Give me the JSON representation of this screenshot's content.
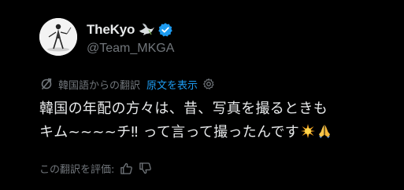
{
  "post": {
    "display_name": "TheKyo",
    "handle": "@Team_MKGA",
    "translation": {
      "translated_from": "韓国語からの翻訳",
      "show_original": "原文を表示"
    },
    "text_lines": [
      "韓国の年配の方々は、昔、写真を撮るときも",
      "キム~~~~チ‼ って言って撮ったんです"
    ],
    "rate_translation": "この翻訳を評価:"
  },
  "icons": {
    "dove": "dove-icon",
    "verified": "verified-badge-icon",
    "translate": "translate-icon",
    "settings": "gear-icon",
    "sparkle": "glowing-star-emoji",
    "pray": "folded-hands-emoji",
    "thumbs_up": "thumbs-up-icon",
    "thumbs_down": "thumbs-down-icon"
  },
  "colors": {
    "background": "#000000",
    "text_primary": "#e7e9ea",
    "text_secondary": "#71767b",
    "link": "#1d9bf0",
    "verified": "#1d9bf0"
  }
}
